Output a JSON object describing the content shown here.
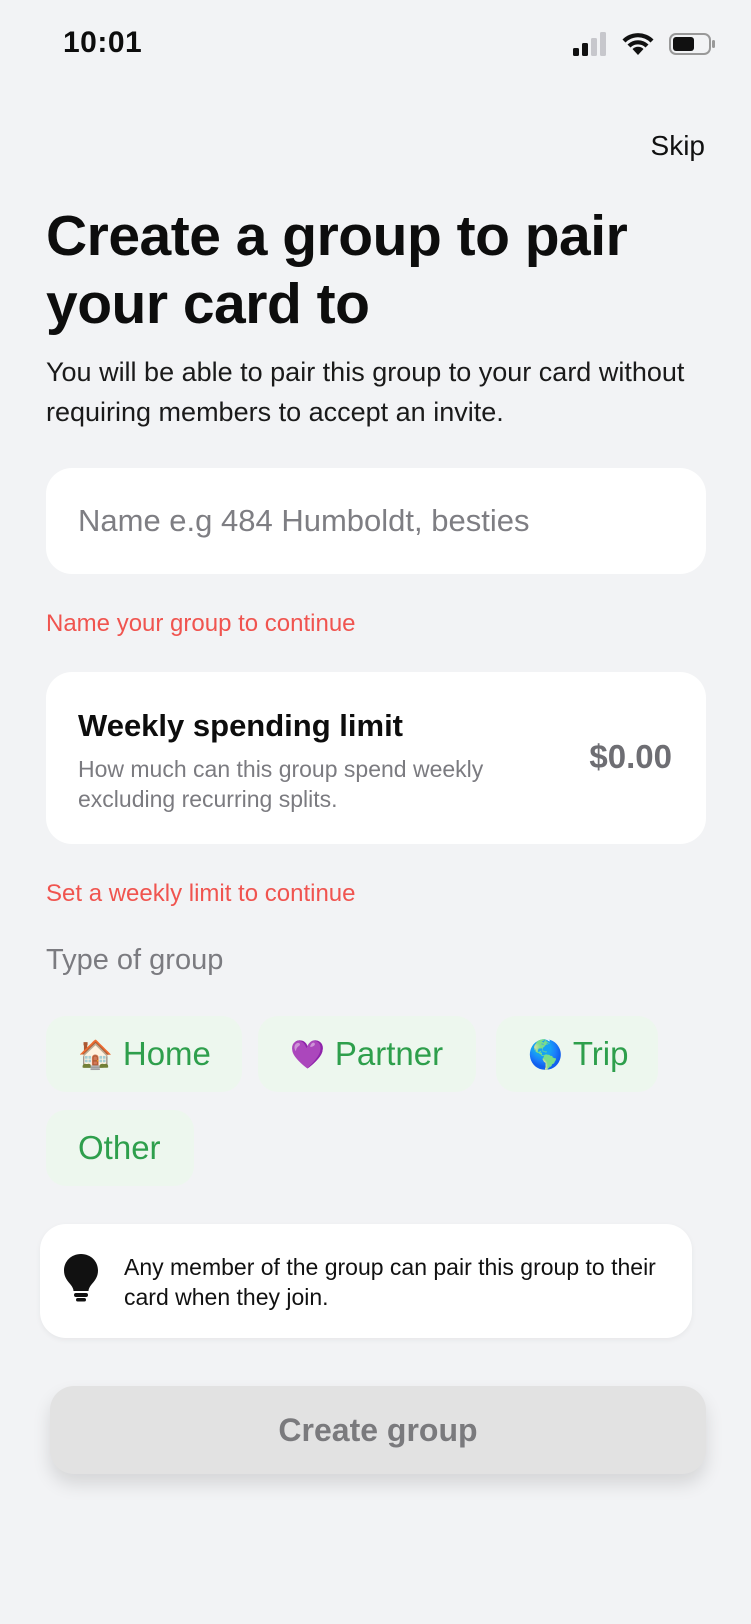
{
  "status_bar": {
    "time": "10:01"
  },
  "header": {
    "skip_label": "Skip"
  },
  "main": {
    "title": "Create a group to pair your card to",
    "subtitle": "You will be able to pair this group to your card without requiring members to accept an invite.",
    "name_field": {
      "value": "",
      "placeholder": "Name e.g 484 Humboldt, besties"
    },
    "name_error": "Name your group to continue",
    "limit": {
      "title": "Weekly spending limit",
      "description": "How much can this group spend weekly excluding recurring splits.",
      "amount": "$0.00"
    },
    "limit_error": "Set a weekly limit to continue",
    "type_label": "Type of group",
    "types": [
      {
        "emoji": "🏠",
        "label": "Home"
      },
      {
        "emoji": "💜",
        "label": "Partner"
      },
      {
        "emoji": "🌎",
        "label": "Trip"
      },
      {
        "emoji": "",
        "label": "Other"
      }
    ],
    "tip": "Any member of the group can pair this group to their card when they join.",
    "create_label": "Create group"
  },
  "colors": {
    "background": "#f2f3f5",
    "error": "#f0544f",
    "chip_bg": "#edf7ee",
    "chip_text": "#2e9f4c",
    "button_disabled": "#e2e2e2"
  },
  "icons": [
    "signal-icon",
    "wifi-icon",
    "battery-icon",
    "lightbulb-icon"
  ]
}
